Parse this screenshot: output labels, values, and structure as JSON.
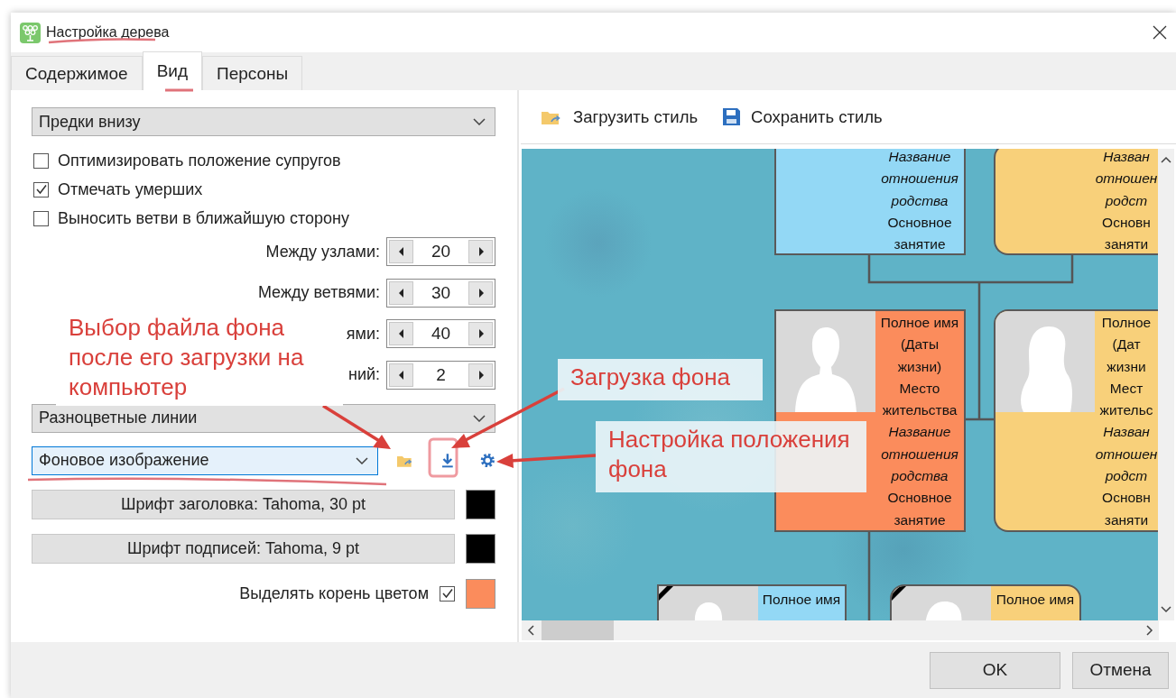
{
  "window": {
    "title": "Настройка дерева"
  },
  "tabs": [
    {
      "label": "Содержимое",
      "selected": false
    },
    {
      "label": "Вид",
      "selected": true
    },
    {
      "label": "Персоны",
      "selected": false
    }
  ],
  "layout_dropdown": {
    "value": "Предки внизу"
  },
  "options": [
    {
      "label": "Оптимизировать положение супругов",
      "checked": false
    },
    {
      "label": "Отмечать умерших",
      "checked": true
    },
    {
      "label": "Выносить ветви в ближайшую сторону",
      "checked": false
    }
  ],
  "spacing": [
    {
      "label": "Между узлами:",
      "value": "20"
    },
    {
      "label": "Между ветвями:",
      "value": "30"
    },
    {
      "label": "ями:",
      "value": "40"
    },
    {
      "label": "ний:",
      "value": "2"
    }
  ],
  "lines_dropdown": {
    "value": "Разноцветные линии"
  },
  "background_dropdown": {
    "value": "Фоновое изображение"
  },
  "font_buttons": [
    {
      "label": "Шрифт заголовка: Tahoma, 30 pt",
      "color": "#000000"
    },
    {
      "label": "Шрифт подписей: Tahoma, 9 pt",
      "color": "#000000"
    }
  ],
  "root_highlight": {
    "label": "Выделять корень цветом",
    "checked": true,
    "color": "#fb8c5c"
  },
  "style_toolbar": [
    {
      "label": "Загрузить стиль",
      "kind": "load"
    },
    {
      "label": "Сохранить стиль",
      "kind": "save"
    }
  ],
  "tree_nodes": [
    {
      "color": "#93d8f5",
      "rounded": false,
      "kind": "text",
      "lines": [
        {
          "text": "Название",
          "italic": true
        },
        {
          "text": "отношения",
          "italic": true
        },
        {
          "text": "родства",
          "italic": true
        },
        {
          "text": "Основное",
          "italic": false
        },
        {
          "text": "занятие",
          "italic": false
        }
      ]
    },
    {
      "color": "#f8d07a",
      "rounded": true,
      "kind": "text",
      "lines": [
        {
          "text": "Назван",
          "italic": true
        },
        {
          "text": "отношен",
          "italic": true
        },
        {
          "text": "родст",
          "italic": true
        },
        {
          "text": "Основн",
          "italic": false
        },
        {
          "text": "заняти",
          "italic": false
        }
      ]
    },
    {
      "color": "#fb8c5c",
      "rounded": false,
      "deceased": false,
      "kind": "male",
      "lines": [
        {
          "text": "Полное имя",
          "italic": false
        },
        {
          "text": "(Даты",
          "italic": false
        },
        {
          "text": "жизни)",
          "italic": false
        },
        {
          "text": "Место",
          "italic": false
        },
        {
          "text": "жительства",
          "italic": false
        },
        {
          "text": "Название",
          "italic": true
        },
        {
          "text": "отношения",
          "italic": true
        },
        {
          "text": "родства",
          "italic": true
        },
        {
          "text": "Основное",
          "italic": false
        },
        {
          "text": "занятие",
          "italic": false
        }
      ]
    },
    {
      "color": "#f8d07a",
      "rounded": true,
      "deceased": false,
      "kind": "female",
      "lines": [
        {
          "text": "Полное",
          "italic": false
        },
        {
          "text": "(Дат",
          "italic": false
        },
        {
          "text": "жизни",
          "italic": false
        },
        {
          "text": "Мест",
          "italic": false
        },
        {
          "text": "жительс",
          "italic": false
        },
        {
          "text": "Назван",
          "italic": true
        },
        {
          "text": "отношен",
          "italic": true
        },
        {
          "text": "родст",
          "italic": true
        },
        {
          "text": "Основн",
          "italic": false
        },
        {
          "text": "заняти",
          "italic": false
        }
      ]
    },
    {
      "color": "#93d8f5",
      "rounded": false,
      "deceased": true,
      "kind": "male",
      "lines": [
        {
          "text": "Полное имя",
          "italic": false
        }
      ]
    },
    {
      "color": "#f8d07a",
      "rounded": true,
      "deceased": true,
      "kind": "female",
      "lines": [
        {
          "text": "Полное имя",
          "italic": false
        }
      ]
    }
  ],
  "buttons": [
    "OK",
    "Отмена"
  ],
  "callouts": [
    {
      "text": "Выбор файла фона\nпосле его загрузки на\nкомпьютер"
    },
    {
      "text": "Загрузка фона"
    },
    {
      "text": "Настройка положения\nфона"
    }
  ]
}
